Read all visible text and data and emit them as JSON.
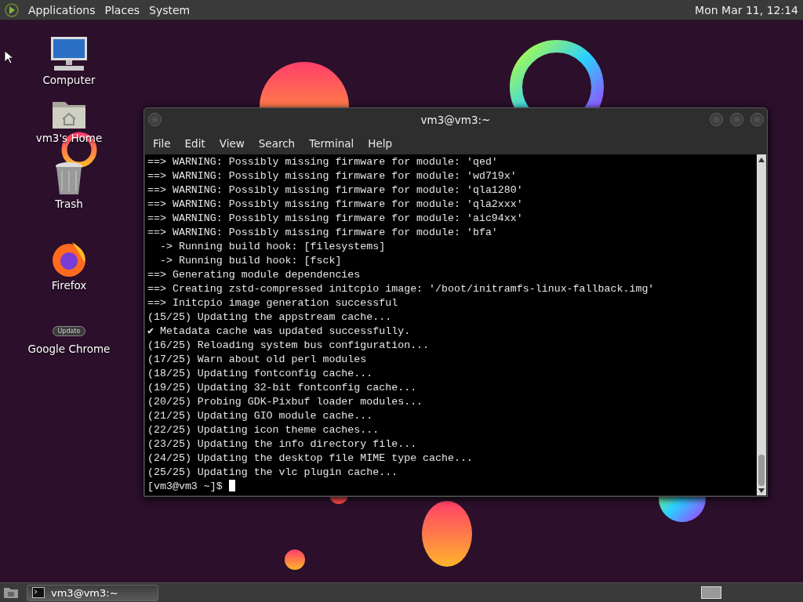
{
  "top_panel": {
    "menus": [
      "Applications",
      "Places",
      "System"
    ],
    "clock": "Mon Mar 11, 12:14"
  },
  "desktop_icons": [
    {
      "kind": "computer",
      "label": "Computer"
    },
    {
      "kind": "home",
      "label": "vm3's Home"
    },
    {
      "kind": "trash",
      "label": "Trash"
    },
    {
      "kind": "firefox",
      "label": "Firefox"
    },
    {
      "kind": "chrome",
      "label": "Google Chrome",
      "badge": "Update"
    }
  ],
  "terminal": {
    "title": "vm3@vm3:~",
    "menu": [
      "File",
      "Edit",
      "View",
      "Search",
      "Terminal",
      "Help"
    ],
    "lines": [
      "==> WARNING: Possibly missing firmware for module: 'qed'",
      "==> WARNING: Possibly missing firmware for module: 'wd719x'",
      "==> WARNING: Possibly missing firmware for module: 'qla1280'",
      "==> WARNING: Possibly missing firmware for module: 'qla2xxx'",
      "==> WARNING: Possibly missing firmware for module: 'aic94xx'",
      "==> WARNING: Possibly missing firmware for module: 'bfa'",
      "  -> Running build hook: [filesystems]",
      "  -> Running build hook: [fsck]",
      "==> Generating module dependencies",
      "==> Creating zstd-compressed initcpio image: '/boot/initramfs-linux-fallback.img'",
      "==> Initcpio image generation successful",
      "(15/25) Updating the appstream cache...",
      "✔ Metadata cache was updated successfully.",
      "(16/25) Reloading system bus configuration...",
      "(17/25) Warn about old perl modules",
      "(18/25) Updating fontconfig cache...",
      "(19/25) Updating 32-bit fontconfig cache...",
      "(20/25) Probing GDK-Pixbuf loader modules...",
      "(21/25) Updating GIO module cache...",
      "(22/25) Updating icon theme caches...",
      "(23/25) Updating the info directory file...",
      "(24/25) Updating the desktop file MIME type cache...",
      "(25/25) Updating the vlc plugin cache..."
    ],
    "prompt": "[vm3@vm3 ~]$"
  },
  "taskbar": {
    "tasks": [
      {
        "label": "vm3@vm3:~",
        "selected": false
      }
    ]
  }
}
